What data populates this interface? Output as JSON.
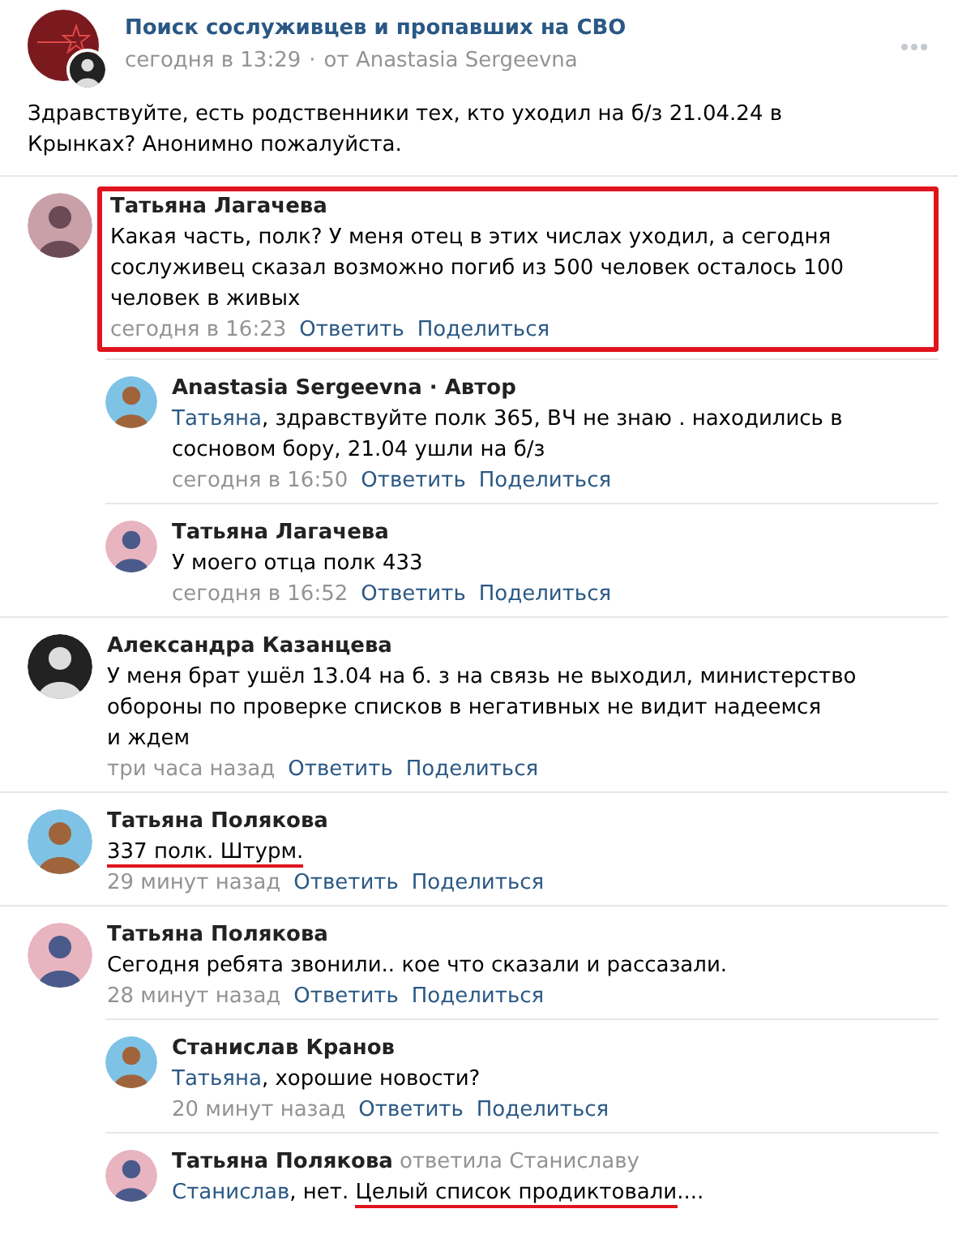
{
  "post": {
    "group": "Поиск сослуживцев и пропавших на СВО",
    "time": "сегодня в 13:29",
    "separator": "·",
    "author": "от Anastasia Sergeevna",
    "text": "Здравствуйте, есть родственники тех, кто уходил на б/з 21.04.24 в Крынках? Анонимно пожалуйста."
  },
  "comments": [
    {
      "author": "Татьяна Лагачева",
      "highlighted": true,
      "parts": [
        {
          "kind": "plain",
          "text": "Какая часть, полк? У меня отец в этих числах уходил, а сегодня сослуживец сказал возможно погиб из 500 человек осталось 100 человек в живых"
        }
      ],
      "time": "сегодня в 16:23",
      "actions": [
        "Ответить",
        "Поделиться"
      ],
      "children": [
        {
          "author": "Anastasia Sergeevna · Автор",
          "highlighted": false,
          "parts": [
            {
              "kind": "mention",
              "text": "Татьяна"
            },
            {
              "kind": "plain",
              "text": ", здравствуйте полк 365, ВЧ не знаю . находились в сосновом бору, 21.04 ушли на б/з"
            }
          ],
          "time": "сегодня в 16:50",
          "actions": [
            "Ответить",
            "Поделиться"
          ]
        },
        {
          "author": "Татьяна Лагачева",
          "highlighted": false,
          "parts": [
            {
              "kind": "plain",
              "text": "У моего отца полк 433"
            }
          ],
          "time": "сегодня в 16:52",
          "actions": [
            "Ответить",
            "Поделиться"
          ]
        }
      ]
    },
    {
      "author": "Александра Казанцева",
      "highlighted": false,
      "parts": [
        {
          "kind": "plain",
          "text": "У меня брат ушёл 13.04 на б. з на связь не выходил, министерство обороны по проверке списков в негативных не видит надеемся\nи ждем"
        }
      ],
      "time": "три часа назад",
      "actions": [
        "Ответить",
        "Поделиться"
      ]
    },
    {
      "author": "Татьяна Полякова",
      "highlighted": false,
      "parts": [
        {
          "kind": "underlined",
          "text": "337 полк. Штурм."
        }
      ],
      "time": "29 минут назад",
      "actions": [
        "Ответить",
        "Поделиться"
      ]
    },
    {
      "author": "Татьяна Полякова",
      "highlighted": false,
      "parts": [
        {
          "kind": "plain",
          "text": "Сегодня ребята звонили.. кое что сказали и рассазали."
        }
      ],
      "time": "28 минут назад",
      "actions": [
        "Ответить",
        "Поделиться"
      ],
      "children": [
        {
          "author": "Станислав Кранов",
          "highlighted": false,
          "parts": [
            {
              "kind": "mention",
              "text": "Татьяна"
            },
            {
              "kind": "plain",
              "text": ", хорошие новости?"
            }
          ],
          "time": "20 минут назад",
          "actions": [
            "Ответить",
            "Поделиться"
          ]
        },
        {
          "author": "Татьяна Полякова",
          "reply_to": "ответила Станиславу",
          "highlighted": false,
          "parts": [
            {
              "kind": "mention",
              "text": "Станислав"
            },
            {
              "kind": "plain",
              "text": ", нет. "
            },
            {
              "kind": "underlined",
              "text": "Целый список продиктовали"
            },
            {
              "kind": "plain",
              "text": "...."
            }
          ]
        }
      ]
    }
  ]
}
